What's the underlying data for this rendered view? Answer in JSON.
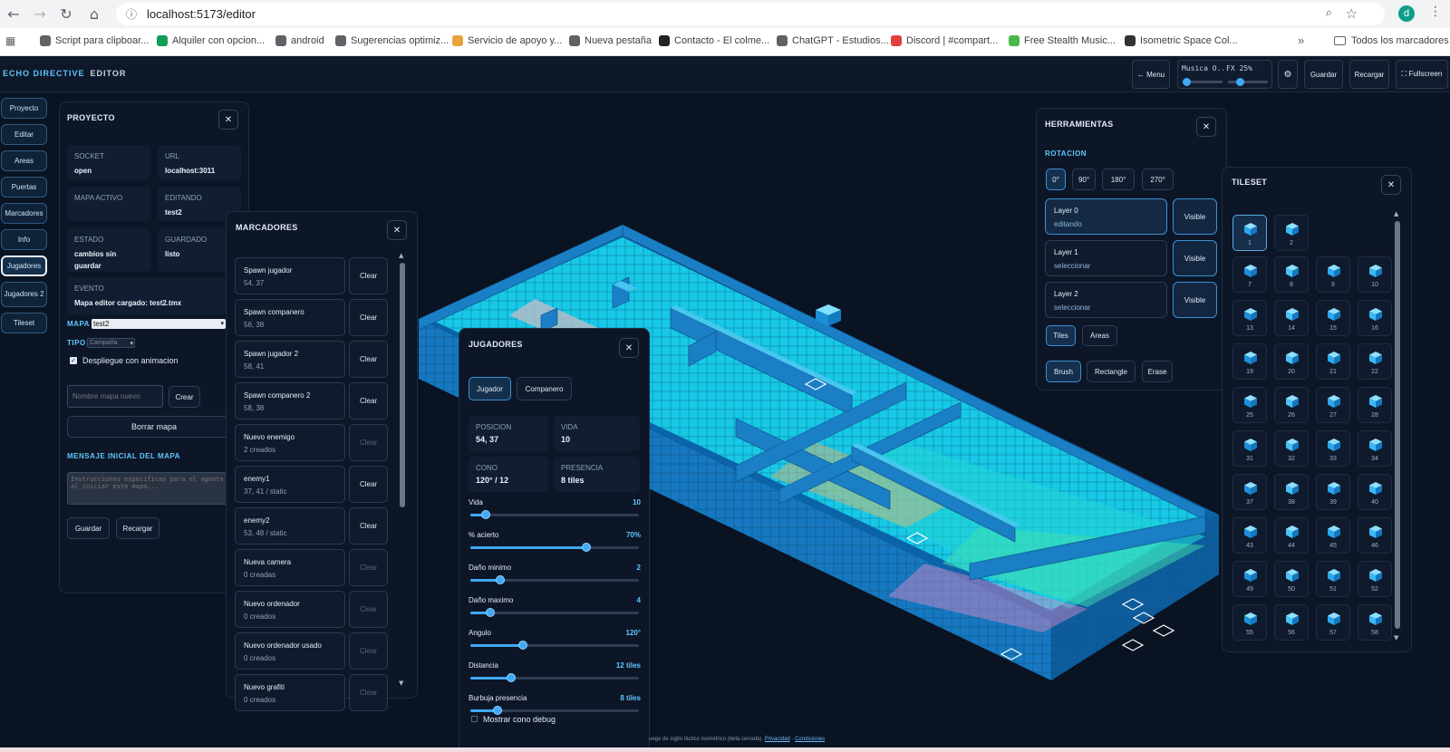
{
  "browser": {
    "url": "localhost:5173/editor",
    "profile_initial": "d",
    "bookmarks": [
      {
        "label": "Script para clipboar...",
        "icon": "globe-icon",
        "color": "#5f6368"
      },
      {
        "label": "Alquiler con opcion...",
        "icon": "sheets-icon",
        "color": "#0f9d58"
      },
      {
        "label": "android",
        "icon": "globe-icon",
        "color": "#5f6368"
      },
      {
        "label": "Sugerencias optimiz...",
        "icon": "globe-icon",
        "color": "#5f6368"
      },
      {
        "label": "Servicio de apoyo y...",
        "icon": "link-icon",
        "color": "#e8a33d"
      },
      {
        "label": "Nueva pestaña",
        "icon": "chrome-icon",
        "color": "#5f6368"
      },
      {
        "label": "Contacto - El colme...",
        "icon": "page-icon",
        "color": "#222222"
      },
      {
        "label": "ChatGPT - Estudios...",
        "icon": "openai-icon",
        "color": "#5f6368"
      },
      {
        "label": "Discord | #compart...",
        "icon": "discord-icon",
        "color": "#e23f3f"
      },
      {
        "label": "Free Stealth Music...",
        "icon": "px-icon",
        "color": "#48b848"
      },
      {
        "label": "Isometric Space Col...",
        "icon": "page-icon",
        "color": "#333333"
      }
    ],
    "all_bookmarks": "Todos los marcadores",
    "more": "»"
  },
  "topbar": {
    "brand": "ECHO DIRECTIVE",
    "brand_sub": "EDITOR",
    "menu": "← Menu",
    "music_label": "Musica O...",
    "music_level": 0.0,
    "fx_label": "FX 25%",
    "fx_level": 0.25,
    "settings": "⚙",
    "save": "Guardar",
    "reload": "Recargar",
    "fullscreen": "⛶ Fullscreen"
  },
  "sidenav": [
    {
      "label": "Proyecto",
      "active": false
    },
    {
      "label": "Editar",
      "active": false
    },
    {
      "label": "Areas",
      "active": false
    },
    {
      "label": "Puertas",
      "active": false
    },
    {
      "label": "Marcadores",
      "active": false
    },
    {
      "label": "Info",
      "active": false
    },
    {
      "label": "Jugadores",
      "active": true
    },
    {
      "label": "Jugadores 2",
      "active": false
    },
    {
      "label": "Tileset",
      "active": false
    }
  ],
  "project": {
    "title": "PROYECTO",
    "cells": [
      {
        "k": "SOCKET",
        "v": "open"
      },
      {
        "k": "URL",
        "v": "localhost:3011"
      },
      {
        "k": "MAPA ACTIVO",
        "v": ""
      },
      {
        "k": "EDITANDO",
        "v": "test2"
      },
      {
        "k": "ESTADO",
        "v": "cambios sin guardar"
      },
      {
        "k": "GUARDADO",
        "v": "listo"
      },
      {
        "k": "EVENTO",
        "v": "Mapa editor cargado: test2.tmx"
      }
    ],
    "map_label": "MAPA",
    "map_value": "test2",
    "type_label": "TIPO",
    "type_value": "Campaña",
    "deploy_label": "Despliegue con animacion",
    "new_map_placeholder": "Nombre mapa nuevo",
    "create": "Crear",
    "delete_map": "Borrar mapa",
    "initial_msg_label": "MENSAJE INICIAL DEL MAPA",
    "initial_msg_placeholder": "Instrucciones especificas para el agente IA al iniciar este mapa...",
    "save": "Guardar",
    "reload": "Recargar"
  },
  "markers": {
    "title": "MARCADORES",
    "items": [
      {
        "t": "Spawn jugador",
        "s": "54, 37",
        "clear": "Clear",
        "dim": false
      },
      {
        "t": "Spawn companero",
        "s": "56, 38",
        "clear": "Clear",
        "dim": false
      },
      {
        "t": "Spawn jugador 2",
        "s": "58, 41",
        "clear": "Clear",
        "dim": false
      },
      {
        "t": "Spawn companero 2",
        "s": "58, 38",
        "clear": "Clear",
        "dim": false
      },
      {
        "t": "Nuevo enemigo",
        "s": "2 creados",
        "clear": "Clear",
        "dim": true
      },
      {
        "t": "enemy1",
        "s": "37, 41 / static",
        "clear": "Clear",
        "dim": false
      },
      {
        "t": "enemy2",
        "s": "53, 48 / static",
        "clear": "Clear",
        "dim": false
      },
      {
        "t": "Nueva camera",
        "s": "0 creadas",
        "clear": "Clear",
        "dim": true
      },
      {
        "t": "Nuevo ordenador",
        "s": "0 creados",
        "clear": "Clear",
        "dim": true
      },
      {
        "t": "Nuevo ordenador usado",
        "s": "0 creados",
        "clear": "Clear",
        "dim": true
      },
      {
        "t": "Nuevo grafiti",
        "s": "0 creados",
        "clear": "Clear",
        "dim": true
      }
    ]
  },
  "players": {
    "title": "JUGADORES",
    "tab_player": "Jugador",
    "tab_companion": "Companero",
    "cells": [
      {
        "k": "POSICION",
        "v": "54, 37"
      },
      {
        "k": "VIDA",
        "v": "10"
      },
      {
        "k": "CONO",
        "v": "120° / 12"
      },
      {
        "k": "PRESENCIA",
        "v": "8 tiles"
      }
    ],
    "sliders": [
      {
        "label": "Vida",
        "value": "10",
        "level": 0.09
      },
      {
        "label": "% acierto",
        "value": "70%",
        "level": 0.69
      },
      {
        "label": "Daño minimo",
        "value": "2",
        "level": 0.18
      },
      {
        "label": "Daño maximo",
        "value": "4",
        "level": 0.12
      },
      {
        "label": "Angulo",
        "value": "120°",
        "level": 0.31
      },
      {
        "label": "Distancia",
        "value": "12 tiles",
        "level": 0.24
      },
      {
        "label": "Burbuja presencia",
        "value": "8 tiles",
        "level": 0.16
      }
    ],
    "debug_label": "Mostrar cono debug"
  },
  "tools": {
    "title": "HERRAMIENTAS",
    "rotation_label": "ROTACION",
    "rotations": [
      "0°",
      "90°",
      "180°",
      "270°"
    ],
    "layers": [
      {
        "n": "Layer 0",
        "m": "editando",
        "vis": "Visible"
      },
      {
        "n": "Layer 1",
        "m": "seleccionar",
        "vis": "Visible"
      },
      {
        "n": "Layer 2",
        "m": "seleccionar",
        "vis": "Visible"
      }
    ],
    "mode_tiles": "Tiles",
    "mode_areas": "Areas",
    "brush": "Brush",
    "rectangle": "Rectangle",
    "erase": "Erase"
  },
  "tileset": {
    "title": "TILESET",
    "tiles": [
      "1",
      "2",
      "7",
      "8",
      "9",
      "10",
      "13",
      "14",
      "15",
      "16",
      "19",
      "20",
      "21",
      "22",
      "25",
      "26",
      "27",
      "28",
      "31",
      "32",
      "33",
      "34",
      "37",
      "38",
      "39",
      "40",
      "43",
      "44",
      "45",
      "46",
      "49",
      "50",
      "51",
      "52",
      "55",
      "56",
      "57",
      "58"
    ]
  },
  "footer": {
    "text": "uego de sigilo táctico isométrico (beta cerrada).",
    "privacy": "Privacidad",
    "sep": "·",
    "terms": "Condiciones"
  },
  "colors": {
    "accent": "#3fa9f5",
    "cyan": "#5fc7ff",
    "floor": "#19d3e6",
    "wall": "#1c7fc4"
  }
}
